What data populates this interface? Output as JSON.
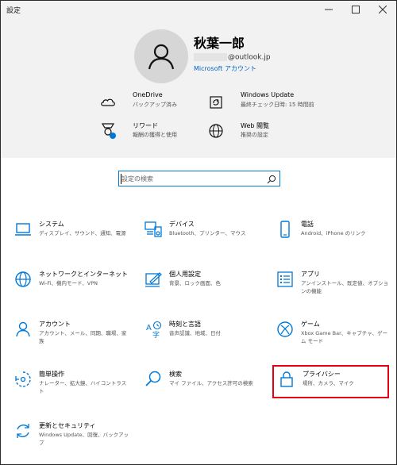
{
  "window": {
    "title": "設定",
    "controls": [
      "minimize-icon",
      "maximize-icon",
      "close-icon"
    ]
  },
  "user": {
    "name": "秋葉一郎",
    "email": "@outlook.jp",
    "account_link": "Microsoft アカウント"
  },
  "header_items": [
    {
      "icon": "cloud-icon",
      "label": "OneDrive",
      "sub": "バックアップ済み"
    },
    {
      "icon": "refresh-icon",
      "label": "Windows Update",
      "sub": "最終チェック日時: 15 時間前"
    },
    {
      "icon": "rewards-icon",
      "label": "リワード",
      "sub": "報酬の獲得と使用"
    },
    {
      "icon": "globe-icon",
      "label": "Web 閲覧",
      "sub": "推奨の設定"
    }
  ],
  "search": {
    "placeholder": "設定の検索"
  },
  "categories": [
    {
      "icon": "laptop-icon",
      "title": "システム",
      "desc": "ディスプレイ、サウンド、通知、電源"
    },
    {
      "icon": "devices-icon",
      "title": "デバイス",
      "desc": "Bluetooth、プリンター、マウス"
    },
    {
      "icon": "phone-icon",
      "title": "電話",
      "desc": "Android、iPhone のリンク"
    },
    {
      "icon": "globe-icon",
      "title": "ネットワークとインターネット",
      "desc": "Wi-Fi、機内モード、VPN"
    },
    {
      "icon": "personalization-icon",
      "title": "個人用設定",
      "desc": "背景、ロック画面、色"
    },
    {
      "icon": "apps-icon",
      "title": "アプリ",
      "desc": "アンインストール、既定値、オプションの機能"
    },
    {
      "icon": "person-icon",
      "title": "アカウント",
      "desc": "アカウント、メール、同期、職場、家族"
    },
    {
      "icon": "time-language-icon",
      "title": "時刻と言語",
      "desc": "音声認識、地域、日付"
    },
    {
      "icon": "xbox-icon",
      "title": "ゲーム",
      "desc": "Xbox Game Bar、キャプチャ、ゲーム モード"
    },
    {
      "icon": "ease-of-access-icon",
      "title": "簡単操作",
      "desc": "ナレーター、拡大鏡、ハイコントラスト"
    },
    {
      "icon": "search-icon",
      "title": "検索",
      "desc": "マイ ファイル、アクセス許可の検索"
    },
    {
      "icon": "lock-icon",
      "title": "プライバシー",
      "desc": "場所、カメラ、マイク"
    },
    {
      "icon": "update-security-icon",
      "title": "更新とセキュリティ",
      "desc": "Windows Update、回復、バックアップ"
    }
  ],
  "colors": {
    "accent": "#0078d7",
    "header_bg": "#f2f2f2",
    "highlight": "#e60012"
  }
}
